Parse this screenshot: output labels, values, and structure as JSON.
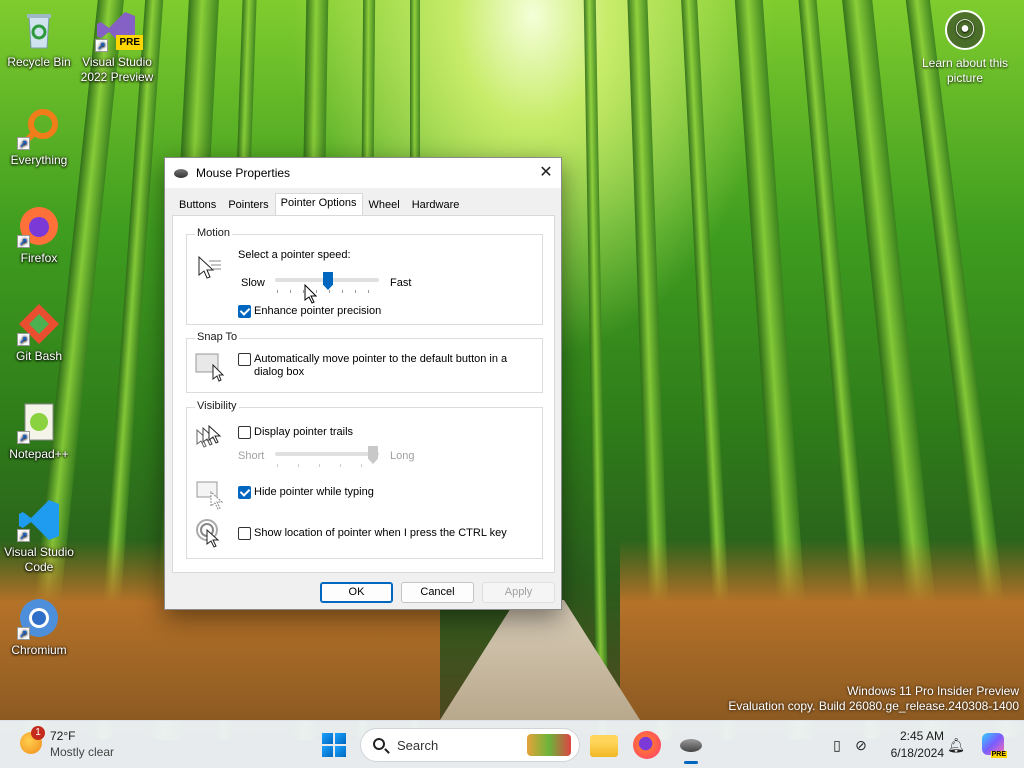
{
  "desktop": {
    "icons": [
      {
        "label": "Recycle Bin",
        "icon": "recycle-bin-icon"
      },
      {
        "label": "Visual Studio 2022 Preview",
        "icon": "visual-studio-preview-icon",
        "badge": "PRE"
      },
      {
        "label": "Everything",
        "icon": "everything-search-icon"
      },
      {
        "label": "Firefox",
        "icon": "firefox-icon"
      },
      {
        "label": "Git Bash",
        "icon": "git-bash-icon"
      },
      {
        "label": "Notepad++",
        "icon": "notepad-plus-plus-icon"
      },
      {
        "label": "Visual Studio Code",
        "icon": "vscode-icon"
      },
      {
        "label": "Chromium",
        "icon": "chromium-icon"
      }
    ],
    "learn_label": "Learn about this picture",
    "watermark_line1": "Windows 11 Pro Insider Preview",
    "watermark_line2": "Evaluation copy. Build 26080.ge_release.240308-1400"
  },
  "dialog": {
    "title": "Mouse Properties",
    "tabs": [
      "Buttons",
      "Pointers",
      "Pointer Options",
      "Wheel",
      "Hardware"
    ],
    "active_tab": "Pointer Options",
    "motion": {
      "group_label": "Motion",
      "speed_label": "Select a pointer speed:",
      "slow": "Slow",
      "fast": "Fast",
      "speed_value": 0.5,
      "precision_label": "Enhance pointer precision",
      "precision_checked": true
    },
    "snap": {
      "group_label": "Snap To",
      "snap_label": "Automatically move pointer to the default button in a dialog box",
      "snap_checked": false
    },
    "visibility": {
      "group_label": "Visibility",
      "trails_label": "Display pointer trails",
      "trails_checked": false,
      "short": "Short",
      "long": "Long",
      "trails_value": 1.0,
      "hide_label": "Hide pointer while typing",
      "hide_checked": true,
      "ctrl_label": "Show location of pointer when I press the CTRL key",
      "ctrl_checked": false
    },
    "buttons": {
      "ok": "OK",
      "cancel": "Cancel",
      "apply": "Apply"
    }
  },
  "taskbar": {
    "weather_temp": "72°F",
    "weather_cond": "Mostly clear",
    "weather_badge": "1",
    "search_placeholder": "Search",
    "time": "2:45 AM",
    "date": "6/18/2024",
    "copilot_badge": "PRE"
  },
  "colors": {
    "accent": "#0067c0"
  }
}
